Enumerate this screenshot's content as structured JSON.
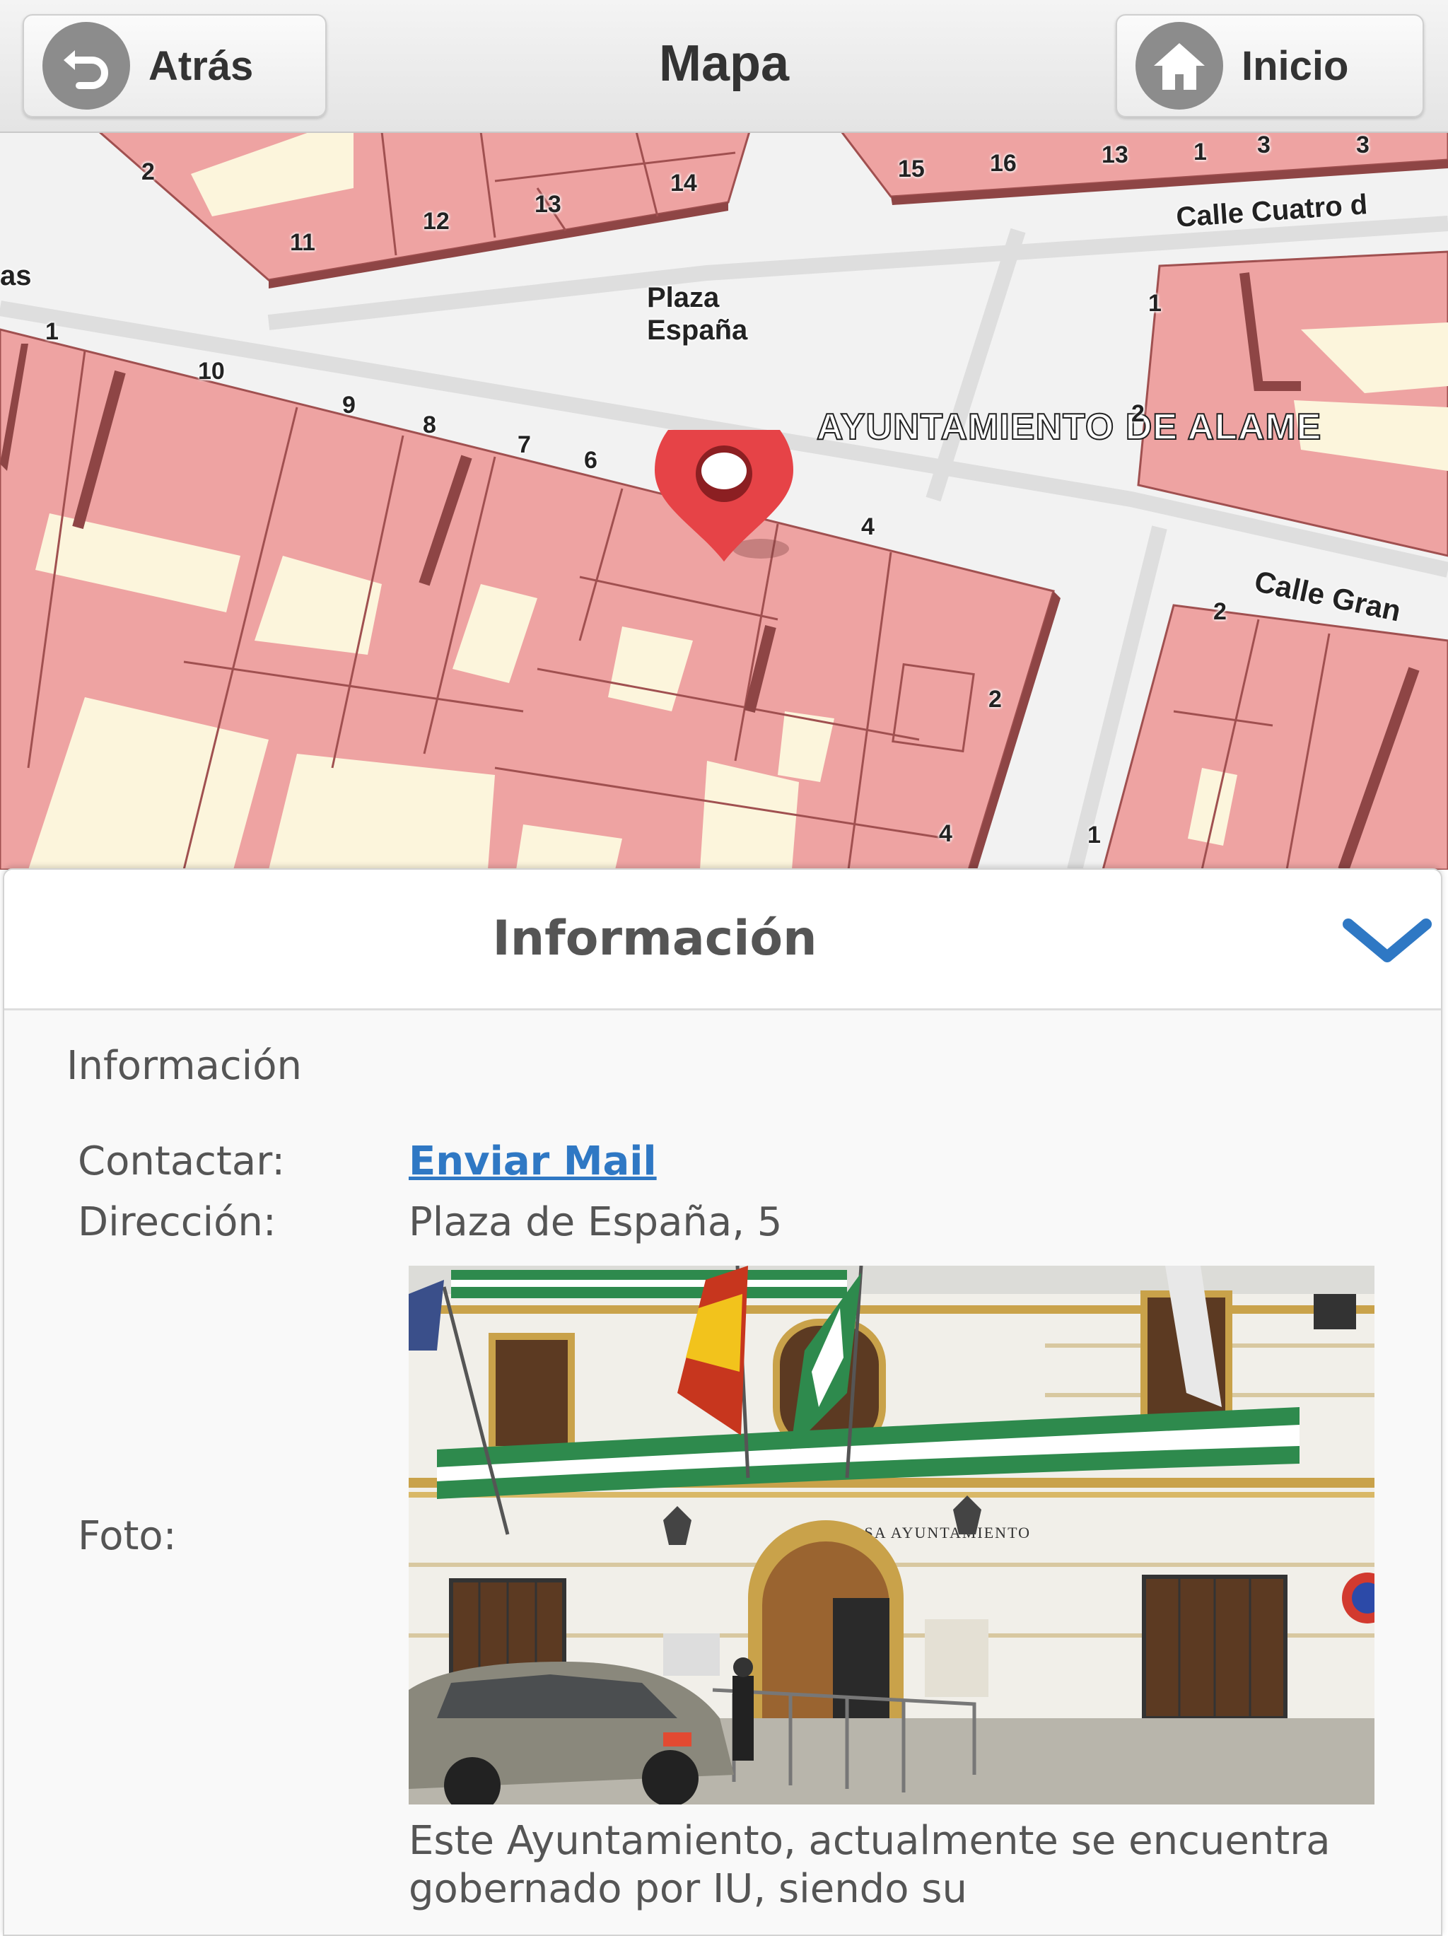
{
  "header": {
    "back_label": "Atrás",
    "title": "Mapa",
    "home_label": "Inicio",
    "back_icon": "back-arrow-icon",
    "home_icon": "house-icon"
  },
  "map": {
    "labels": {
      "plaza_line1": "Plaza",
      "plaza_line2": "España",
      "ayuntamiento": "AYUNTAMIENTO DE ALAME",
      "calle_cuatro": "Calle Cuatro d",
      "calle_gran": "Calle Gran",
      "edge_left": "as"
    },
    "numbers": {
      "n2a": "2",
      "n11": "11",
      "n12": "12",
      "n13a": "13",
      "n14": "14",
      "n15": "15",
      "n16": "16",
      "n13b": "13",
      "n1a": "1",
      "n3a": "3",
      "n3b": "3",
      "n1b": "1",
      "n1c": "1",
      "n10": "10",
      "n9": "9",
      "n8": "8",
      "n7": "7",
      "n6": "6",
      "n4a": "4",
      "n2b": "2",
      "n2c": "2",
      "n2d": "2",
      "n4b": "4",
      "n1d": "1"
    },
    "colors": {
      "block": "#eea3a2",
      "block_edge": "#a05050",
      "courtyard": "#fcf5dc",
      "street": "#f2f2f2",
      "marker": "#e64347"
    },
    "marker_icon": "map-pin-icon"
  },
  "info": {
    "title": "Información",
    "collapse_icon": "chevron-down-icon",
    "section_label": "Información",
    "contact_label": "Contactar:",
    "contact_link": "Enviar Mail",
    "address_label": "Dirección:",
    "address_value": "Plaza de España, 5",
    "photo_label": "Foto:",
    "photo_sign": "CASA AYUNTAMIENTO",
    "description": "Este Ayuntamiento, actualmente se encuentra gobernado por IU, siendo su"
  }
}
